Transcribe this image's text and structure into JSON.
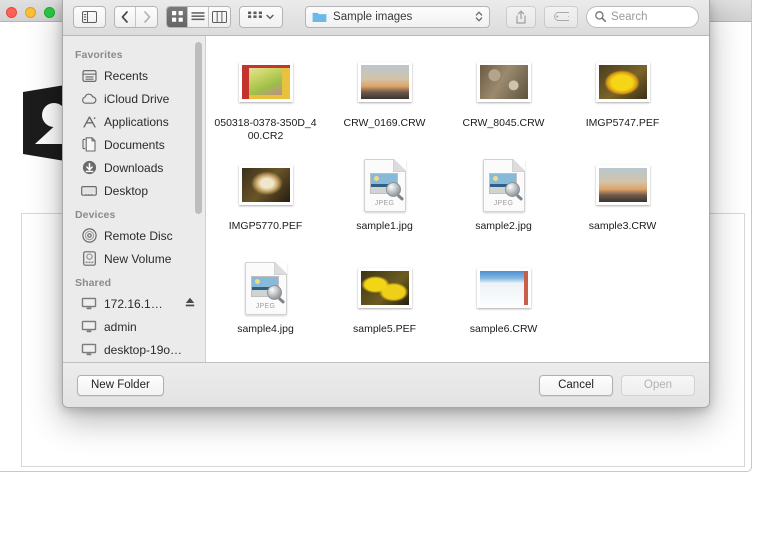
{
  "background_window": {
    "name": "photo-app-window",
    "traffic_lights": [
      "close",
      "minimize",
      "zoom"
    ],
    "placeholder_icon": "photo-placeholder-icon",
    "dropzone_label": ""
  },
  "dialog": {
    "toolbar": {
      "sidebar_toggle_icon": "sidebar-toggle-icon",
      "back_icon": "chevron-left-icon",
      "forward_icon": "chevron-right-icon",
      "view_modes": [
        {
          "name": "icon-view",
          "icon": "grid-icon",
          "active": true,
          "disabled": false
        },
        {
          "name": "list-view",
          "icon": "list-icon",
          "active": false,
          "disabled": false
        },
        {
          "name": "column-view",
          "icon": "columns-icon",
          "active": false,
          "disabled": false
        }
      ],
      "arrange_icon": "arrange-grid-icon",
      "arrange_chevron": "chevron-down-icon",
      "path_folder_icon": "folder-icon",
      "path_label": "Sample images",
      "path_stepper_icon": "stepper-updown-icon",
      "share_icon": "share-icon",
      "tag_icon": "tag-icon",
      "search_icon": "search-icon",
      "search_placeholder": "Search",
      "search_value": ""
    },
    "sidebar": {
      "sections": [
        {
          "title": "Favorites",
          "items": [
            {
              "label": "Recents",
              "icon": "recents-icon",
              "eject": false
            },
            {
              "label": "iCloud Drive",
              "icon": "icloud-icon",
              "eject": false
            },
            {
              "label": "Applications",
              "icon": "applications-icon",
              "eject": false
            },
            {
              "label": "Documents",
              "icon": "documents-icon",
              "eject": false
            },
            {
              "label": "Downloads",
              "icon": "downloads-icon",
              "eject": false
            },
            {
              "label": "Desktop",
              "icon": "desktop-icon",
              "eject": false
            }
          ]
        },
        {
          "title": "Devices",
          "items": [
            {
              "label": "Remote Disc",
              "icon": "disc-icon",
              "eject": false
            },
            {
              "label": "New Volume",
              "icon": "harddrive-icon",
              "eject": false
            }
          ]
        },
        {
          "title": "Shared",
          "items": [
            {
              "label": "172.16.1…",
              "icon": "computer-icon",
              "eject": true
            },
            {
              "label": "admin",
              "icon": "computer-icon",
              "eject": false
            },
            {
              "label": "desktop-19o…",
              "icon": "computer-icon",
              "eject": false
            }
          ]
        }
      ]
    },
    "files": [
      {
        "name": "050318-0378-350D_400.CR2",
        "kind": "photo",
        "thumb": "flowers-rose"
      },
      {
        "name": "CRW_0169.CRW",
        "kind": "photo",
        "thumb": "sunset-sea"
      },
      {
        "name": "CRW_8045.CRW",
        "kind": "photo",
        "thumb": "rock-texture"
      },
      {
        "name": "IMGP5747.PEF",
        "kind": "photo",
        "thumb": "yellow-flower"
      },
      {
        "name": "IMGP5770.PEF",
        "kind": "photo",
        "thumb": "dark-bloom"
      },
      {
        "name": "sample1.jpg",
        "kind": "jpeg-doc",
        "badge": "JPEG"
      },
      {
        "name": "sample2.jpg",
        "kind": "jpeg-doc",
        "badge": "JPEG"
      },
      {
        "name": "sample3.CRW",
        "kind": "photo",
        "thumb": "sunset-sea"
      },
      {
        "name": "sample4.jpg",
        "kind": "jpeg-doc",
        "badge": "JPEG"
      },
      {
        "name": "sample5.PEF",
        "kind": "photo",
        "thumb": "yellow-leaves"
      },
      {
        "name": "sample6.CRW",
        "kind": "photo",
        "thumb": "snow-scene"
      }
    ],
    "footer": {
      "new_folder_label": "New Folder",
      "cancel_label": "Cancel",
      "open_label": "Open",
      "open_disabled": true
    }
  },
  "colors": {
    "toolbar_bg": "#ececec",
    "sidebar_bg": "#ebebeb",
    "filepane_bg": "#ffffff",
    "folder_blue": "#6cb9e8",
    "active_segment": "#6d6d6d",
    "text": "#1c1c1c",
    "muted_text": "#8b8b8b"
  }
}
